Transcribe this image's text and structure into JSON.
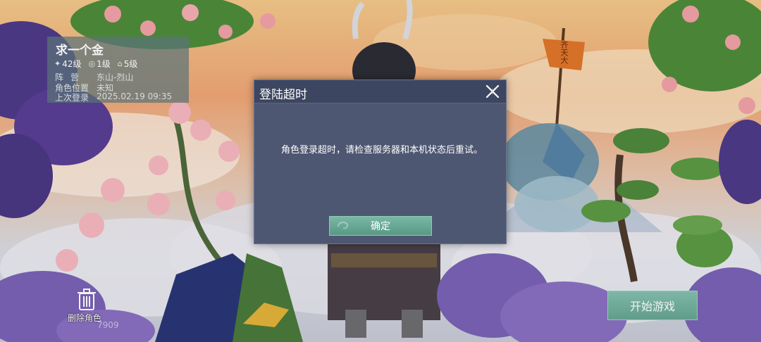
{
  "character": {
    "name": "求一个金",
    "stats": [
      {
        "icon": "wing-icon",
        "value": "42级"
      },
      {
        "icon": "swirl-icon",
        "value": "1级"
      },
      {
        "icon": "house-icon",
        "value": "5级"
      }
    ],
    "camp_label": "阵营",
    "camp_value": "东山-烈山",
    "position_label": "角色位置",
    "position_value": "未知",
    "last_login_label": "上次登录",
    "last_login_value": "2025.02.19 09:35"
  },
  "dialog": {
    "title": "登陆超时",
    "message": "角色登录超时，请检查服务器和本机状态后重试。",
    "confirm_label": "确定"
  },
  "bottom": {
    "delete_label": "删除角色",
    "uid_fragment": "7909",
    "start_label": "开始游戏"
  },
  "banner_text": "齐天大",
  "colors": {
    "panel_bg": "#607a80",
    "dialog_bg": "#4e5772",
    "button_accent": "#6aa896"
  }
}
